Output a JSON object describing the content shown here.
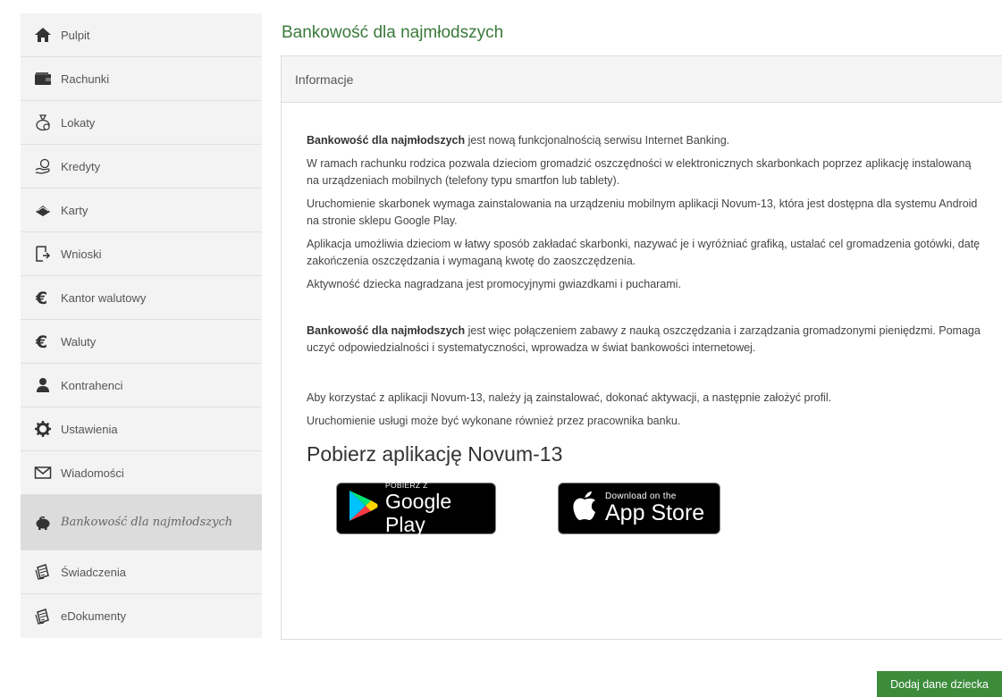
{
  "sidebar": {
    "items": [
      {
        "label": "Pulpit",
        "icon": "home-icon"
      },
      {
        "label": "Rachunki",
        "icon": "wallet-icon"
      },
      {
        "label": "Lokaty",
        "icon": "money-bag-icon"
      },
      {
        "label": "Kredyty",
        "icon": "coins-hand-icon"
      },
      {
        "label": "Karty",
        "icon": "card-icon"
      },
      {
        "label": "Wnioski",
        "icon": "document-arrow-icon"
      },
      {
        "label": "Kantor walutowy",
        "icon": "euro-icon"
      },
      {
        "label": "Waluty",
        "icon": "euro-icon"
      },
      {
        "label": "Kontrahenci",
        "icon": "person-icon"
      },
      {
        "label": "Ustawienia",
        "icon": "gear-icon"
      },
      {
        "label": "Wiadomości",
        "icon": "envelope-icon"
      },
      {
        "label": "Bankowość dla najmłodszych",
        "icon": "piggy-bank-icon",
        "active": true
      },
      {
        "label": "Świadczenia",
        "icon": "documents-icon"
      },
      {
        "label": "eDokumenty",
        "icon": "documents-icon"
      }
    ]
  },
  "main": {
    "title": "Bankowość dla najmłodszych",
    "panel_title": "Informacje",
    "p1_bold": "Bankowość dla najmłodszych",
    "p1_rest": " jest nową funkcjonalnością serwisu Internet Banking.",
    "p2": "W ramach rachunku rodzica pozwala dzieciom gromadzić oszczędności w elektronicznych skarbonkach poprzez aplikację instalowaną na urządzeniach mobilnych (telefony typu smartfon lub tablety).",
    "p3": "Uruchomienie skarbonek wymaga zainstalowania na urządzeniu mobilnym aplikacji Novum-13, która jest dostępna dla systemu Android na stronie sklepu Google Play.",
    "p4": "Aplikacja umożliwia dzieciom w łatwy sposób zakładać skarbonki, nazywać je i wyróżniać grafiką, ustalać cel gromadzenia gotówki, datę zakończenia oszczędzania i wymaganą kwotę do zaoszczędzenia.",
    "p5": "Aktywność dziecka nagradzana jest promocyjnymi gwiazdkami i pucharami.",
    "p6_bold": "Bankowość dla najmłodszych",
    "p6_rest": " jest więc połączeniem zabawy z nauką oszczędzania i zarządzania gromadzonymi pieniędzmi. Pomaga uczyć odpowiedzialności i systematyczności, wprowadza w świat bankowości internetowej.",
    "p7": "Aby korzystać z aplikacji Novum-13, należy ją zainstalować, dokonać aktywacji, a następnie założyć profil.",
    "p8": "Uruchomienie usługi może być wykonane również przez pracownika banku.",
    "download_title": "Pobierz aplikację Novum-13",
    "google_play": {
      "small": "POBIERZ Z",
      "big": "Google Play"
    },
    "app_store": {
      "small": "Download on the",
      "big": "App Store"
    },
    "add_button": "Dodaj dane dziecka"
  },
  "colors": {
    "accent_green": "#3c8c3c",
    "title_green": "#3a7a3a",
    "sidebar_bg": "#f3f3f3",
    "sidebar_active": "#dcdcdc"
  }
}
